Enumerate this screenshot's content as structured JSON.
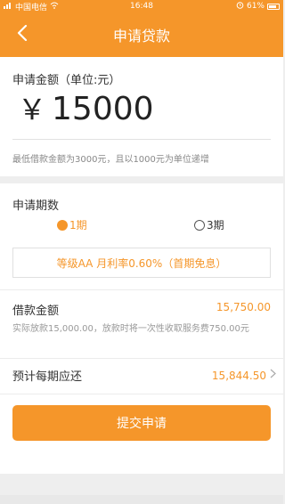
{
  "status": {
    "carrier": "中国电信",
    "time": "16:48",
    "battery": "61%"
  },
  "nav": {
    "title": "申请贷款",
    "back_icon": "chevron-left-icon"
  },
  "amount": {
    "label": "申请金额（单位:元）",
    "currency": "￥",
    "value": "15000",
    "hint": "最低借款金额为3000元，且以1000元为单位递增"
  },
  "period": {
    "label": "申请期数",
    "options": [
      {
        "label": "1期",
        "selected": true
      },
      {
        "label": "3期",
        "selected": false
      }
    ],
    "rate_text": "等级AA 月利率0.60%（首期免息）"
  },
  "loan": {
    "label": "借款金额",
    "value": "15,750.00",
    "note": "实际放款15,000.00，放款时将一次性收取服务费750.00元"
  },
  "monthly": {
    "label": "预计每期应还",
    "value": "15,844.50"
  },
  "submit_label": "提交申请",
  "colors": {
    "accent": "#f5962a"
  }
}
